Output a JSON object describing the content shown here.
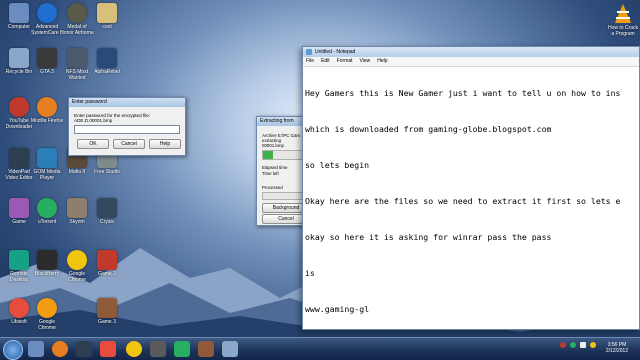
{
  "desktop": {
    "icons": [
      {
        "label": "Computer",
        "color": "#6b8cc0"
      },
      {
        "label": "Advanced SystemCare 5",
        "color": "#1e6fd0"
      },
      {
        "label": "Medal of Honor Airborne",
        "color": "#5a5a4a"
      },
      {
        "label": "cool",
        "color": "#d8c07a"
      },
      {
        "label": "Recycle Bin",
        "color": "#8aa6c8"
      },
      {
        "label": "GTA 3",
        "color": "#3a3a3a"
      },
      {
        "label": "NFS Most Wanted",
        "color": "#4a5a6a"
      },
      {
        "label": "AlphaRebel",
        "color": "#2a4a7a"
      },
      {
        "label": "YouTube Downloader",
        "color": "#c0392b"
      },
      {
        "label": "Mozilla Firefox",
        "color": "#e67e22"
      },
      {
        "label": "VideoPad Video Editor",
        "color": "#2c3e50"
      },
      {
        "label": "GOM Media Player",
        "color": "#2980b9"
      },
      {
        "label": "Mafia II",
        "color": "#5b4a3a"
      },
      {
        "label": "Free Studio",
        "color": "#7f8c8d"
      },
      {
        "label": "uTorrent",
        "color": "#27ae60"
      },
      {
        "label": "Skyrim",
        "color": "#8e7e6e"
      },
      {
        "label": "Crysis",
        "color": "#34495e"
      },
      {
        "label": "Game",
        "color": "#9b59b6"
      },
      {
        "label": "Remote Desktop",
        "color": "#16a085"
      },
      {
        "label": "BlackBerry",
        "color": "#2c2c2c"
      },
      {
        "label": "Google Chrome",
        "color": "#f1c40f"
      },
      {
        "label": "Game 2",
        "color": "#c0392b"
      },
      {
        "label": "Ubisoft",
        "color": "#e74c3c"
      },
      {
        "label": "Google Chrome",
        "color": "#f39c12"
      },
      {
        "label": "Game 3",
        "color": "#8e5a3a"
      }
    ]
  },
  "password_dialog": {
    "title": "Enter password",
    "prompt": "Enter password for the encrypted file:",
    "filename": "ADE.D.00001.bmp",
    "ok": "OK",
    "cancel": "Cancel",
    "help": "Help"
  },
  "extract_dialog": {
    "title": "Extracting from",
    "archive_line": "Archive E:\\PC Gam",
    "extracting": "extracting",
    "file": "00001.bmp",
    "elapsed": "Elapsed time",
    "left": "Time left",
    "processed": "Processed",
    "background": "Background",
    "cancel": "Cancel"
  },
  "notepad": {
    "title": "Untitled - Notepad",
    "menu": [
      "File",
      "Edit",
      "Format",
      "View",
      "Help"
    ],
    "lines": [
      "Hey Gamers this is New Gamer just i want to tell u on how to ins",
      "which is downloaded from gaming-globe.blogspot.com",
      "so lets begin",
      "Okay here are the files so we need to extract it first so lets e",
      "okay so here it is asking for winrar pass the pass",
      "is",
      "www.gaming-gl"
    ]
  },
  "vlc_icon": {
    "label": "How to Crack a Program"
  },
  "taskbar": {
    "time": "3:56 PM",
    "date": "2/12/2012"
  }
}
